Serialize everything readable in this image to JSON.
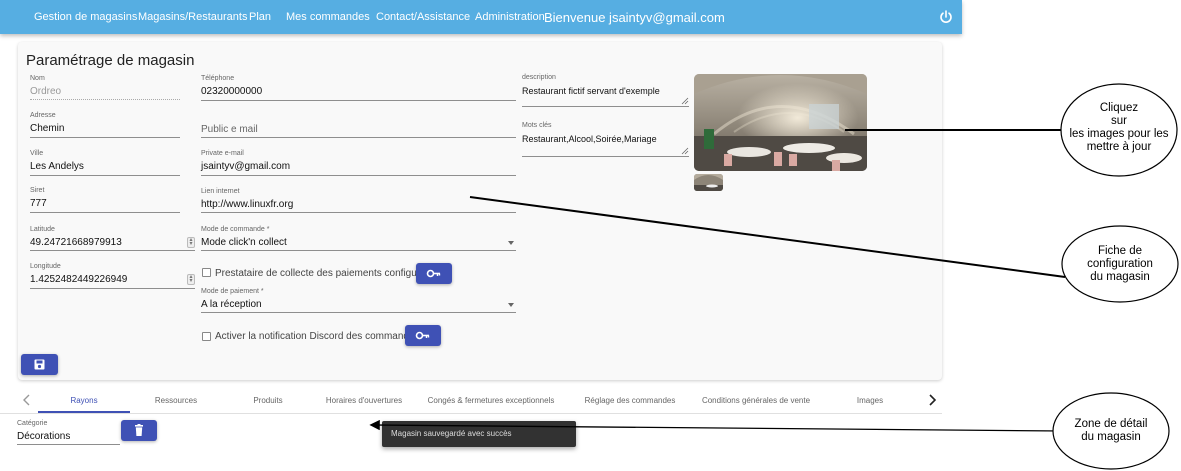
{
  "nav": {
    "items": [
      "Gestion de magasins",
      "Magasins/Restaurants",
      "Plan",
      "Mes commandes",
      "Contact/Assistance",
      "Administration"
    ],
    "welcome": "Bienvenue jsaintyv@gmail.com",
    "power_icon": "power-icon"
  },
  "card": {
    "title": "Paramétrage de magasin",
    "fields": {
      "nom": {
        "label": "Nom",
        "value": "Ordreo"
      },
      "adresse": {
        "label": "Adresse",
        "value": "Chemin"
      },
      "ville": {
        "label": "Ville",
        "value": "Les Andelys"
      },
      "siret": {
        "label": "Siret",
        "value": "777"
      },
      "latitude": {
        "label": "Latitude",
        "value": "49.24721668979913"
      },
      "longitude": {
        "label": "Longitude",
        "value": "1.4252482449226949"
      },
      "telephone": {
        "label": "Téléphone",
        "value": "02320000000"
      },
      "public_email": {
        "placeholder": "Public e mail"
      },
      "private_email": {
        "label": "Private e-mail",
        "value": "jsaintyv@gmail.com"
      },
      "lien": {
        "label": "Lien internet",
        "value": "http://www.linuxfr.org"
      },
      "mode_commande": {
        "label": "Mode de commande *",
        "value": "Mode click'n collect"
      },
      "prestataire": {
        "label": "Prestataire de collecte des paiements configurés."
      },
      "mode_paiement": {
        "label": "Mode de paiement *",
        "value": "A la réception"
      },
      "discord": {
        "label": "Activer la notification Discord des commandes"
      },
      "description": {
        "label": "description",
        "value": "Restaurant fictif servant d'exemple"
      },
      "mots_cles": {
        "label": "Mots clés",
        "value": "Restaurant,Alcool,Soirée,Mariage"
      }
    },
    "icons": {
      "key": "key-icon",
      "save": "save-icon",
      "delete": "delete-icon"
    }
  },
  "tabs": [
    "Rayons",
    "Ressources",
    "Produits",
    "Horaires d'ouvertures",
    "Congés & fermetures exceptionnels",
    "Réglage des commandes",
    "Conditions générales de vente",
    "Images"
  ],
  "active_tab": "Rayons",
  "detail": {
    "categorie_label": "Catégorie",
    "categorie_value": "Décorations"
  },
  "snackbar": "Magasin sauvegardé avec succès",
  "annotations": {
    "images": [
      "Cliquez",
      "sur",
      "les images pour les",
      "mettre à jour"
    ],
    "fiche": [
      "Fiche de",
      "configuration",
      "du magasin"
    ],
    "zone": [
      "Zone de détail",
      "du magasin"
    ]
  },
  "colors": {
    "appbar": "#56aee2",
    "primary": "#3f51b5",
    "snackbar": "#323232"
  }
}
